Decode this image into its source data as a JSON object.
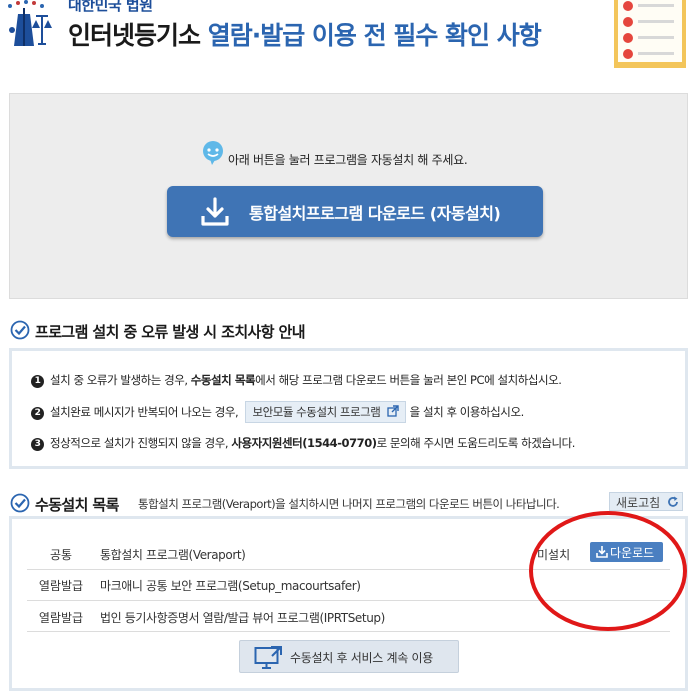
{
  "header": {
    "org_name": "대한민국 법원",
    "title_part1": "인터넷등기소",
    "title_part2": " 열람·발급 이용 전 필수 확인 사항"
  },
  "hero": {
    "message": "아래 버튼을 눌러 프로그램을 자동설치 해 주세요.",
    "download_button": "통합설치프로그램 다운로드 (자동설치)"
  },
  "error_section": {
    "heading": "프로그램 설치 중 오류 발생 시 조치사항 안내",
    "items": [
      {
        "num": "1",
        "pre": "설치 중 오류가 발생하는 경우, ",
        "bold": "수동설치 목록",
        "post": "에서 해당 프로그램 다운로드 버튼을 눌러 본인 PC에 설치하십시오."
      },
      {
        "num": "2",
        "pre": "설치완료 메시지가 반복되어 나오는 경우, ",
        "button": "보안모듈 수동설치 프로그램",
        "post": "을 설치 후 이용하십시오."
      },
      {
        "num": "3",
        "pre": "정상적으로 설치가 진행되지 않을 경우, ",
        "bold": "사용자지원센터(1544-0770)",
        "post": "로 문의해 주시면 도움드리도록 하겠습니다."
      }
    ]
  },
  "manual_section": {
    "heading": "수동설치 목록",
    "note": "통합설치 프로그램(Veraport)을 설치하시면 나머지 프로그램의 다운로드 버튼이 나타납니다.",
    "refresh_label": "새로고침",
    "rows": [
      {
        "category": "공통",
        "name": "통합설치 프로그램(Veraport)",
        "status": "미설치",
        "download_label": "다운로드"
      },
      {
        "category": "열람발급",
        "name": "마크애니 공통 보안 프로그램(Setup_macourtsafer)"
      },
      {
        "category": "열람발급",
        "name": "법인 등기사항증명서 열람/발급 뷰어 프로그램(IPRTSetup)"
      }
    ],
    "continue_label": "수동설치 후 서비스 계속 이용"
  },
  "icons": [
    "court-emblem-icon",
    "checklist-icon",
    "speech-bubble-icon",
    "download-icon",
    "check-circle-icon",
    "external-link-icon",
    "refresh-icon",
    "monitor-link-icon"
  ],
  "colors": {
    "accent": "#2b65b0",
    "button": "#3f74b5",
    "annotation": "#e01818"
  }
}
